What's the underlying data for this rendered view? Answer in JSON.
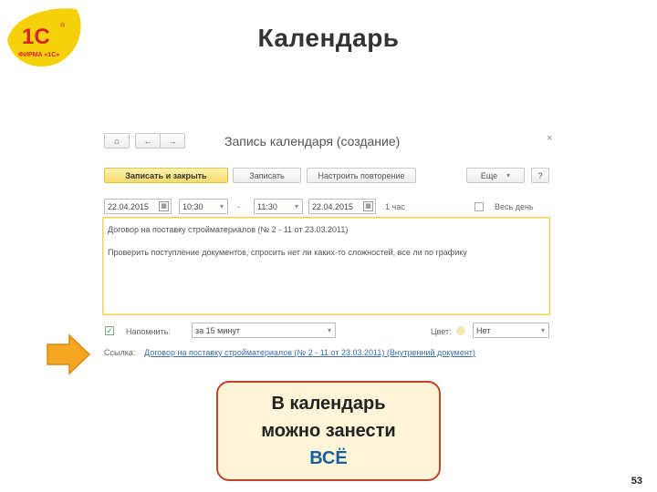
{
  "slide": {
    "title": "Календарь",
    "page_number": "53",
    "logo": {
      "main": "1С",
      "sub": "ФИРМА «1С»",
      "mark": "®"
    }
  },
  "window": {
    "title": "Запись календаря (создание)",
    "close_glyph": "×",
    "nav": {
      "home_glyph": "⌂",
      "back_glyph": "←",
      "forward_glyph": "→"
    },
    "toolbar": {
      "save_close": "Записать и закрыть",
      "save": "Записать",
      "repeat": "Настроить повторение",
      "more": "Еще",
      "more_glyph": "▾",
      "help": "?"
    },
    "datetime": {
      "start_date": "22.04.2015",
      "start_time": "10:30",
      "dash": "-",
      "end_time": "11:30",
      "end_date": "22.04.2015",
      "duration": "1 час",
      "all_day": "Весь день"
    },
    "text": {
      "line1": "Договор на поставку стройматериалов (№ 2 - 11 от 23.03.2011)",
      "line2": "Проверить поступление документов, спросить нет ли каких-то сложностей, все ли по графику"
    },
    "reminder": {
      "label": "Напомнить:",
      "value": "за 15 минут",
      "checked_glyph": "✓",
      "color_label": "Цвет:",
      "color_value": "Нет"
    },
    "link": {
      "label": "Ссылка:",
      "value": "Договор на поставку стройматериалов (№ 2 - 11 от 23.03.2011) (Внутренний документ)"
    }
  },
  "callout": {
    "line1": "В календарь",
    "line2": "можно занести",
    "line3": "ВСЁ"
  },
  "colors": {
    "accent_yellow": "#f7db6c",
    "callout_border": "#c0442a",
    "callout_bg": "#fef5d8",
    "highlight_blue": "#1a5f9e",
    "logo_red": "#d8242b",
    "logo_yellow": "#f5d10c",
    "arrow_orange": "#f5a623"
  }
}
